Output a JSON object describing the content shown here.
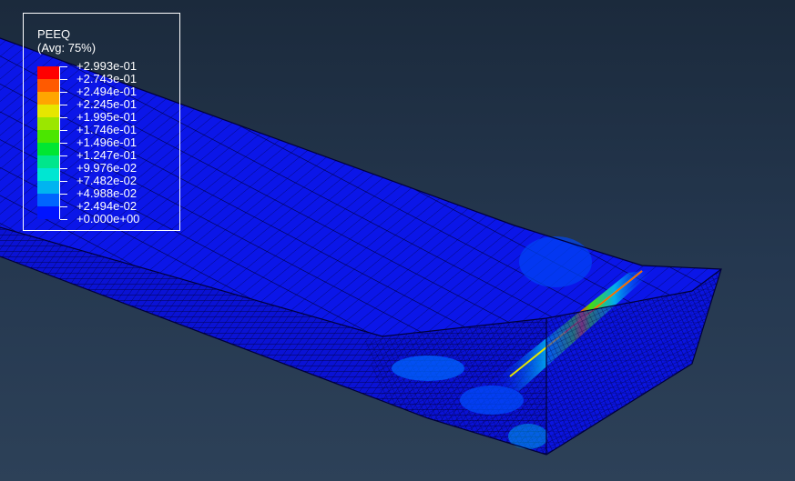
{
  "legend": {
    "title": "PEEQ",
    "subtitle": "(Avg: 75%)",
    "levels": [
      {
        "label": "+2.993e-01",
        "color": "#ff0000"
      },
      {
        "label": "+2.743e-01",
        "color": "#ff5a00"
      },
      {
        "label": "+2.494e-01",
        "color": "#ffa500"
      },
      {
        "label": "+2.245e-01",
        "color": "#e6e600"
      },
      {
        "label": "+1.995e-01",
        "color": "#9be600"
      },
      {
        "label": "+1.746e-01",
        "color": "#4be600"
      },
      {
        "label": "+1.496e-01",
        "color": "#00e632"
      },
      {
        "label": "+1.247e-01",
        "color": "#00e68c"
      },
      {
        "label": "+9.976e-02",
        "color": "#00e6d2"
      },
      {
        "label": "+7.482e-02",
        "color": "#00b4f0"
      },
      {
        "label": "+4.988e-02",
        "color": "#0064ff"
      },
      {
        "label": "+2.494e-02",
        "color": "#0014ff"
      },
      {
        "label": "+0.000e+00",
        "color": "#0000ff"
      }
    ]
  },
  "colors": {
    "mesh_base": "#0a14e6",
    "mesh_lines": "#000033",
    "background_top": "#1b2a3c",
    "background_bottom": "#2d4158"
  }
}
